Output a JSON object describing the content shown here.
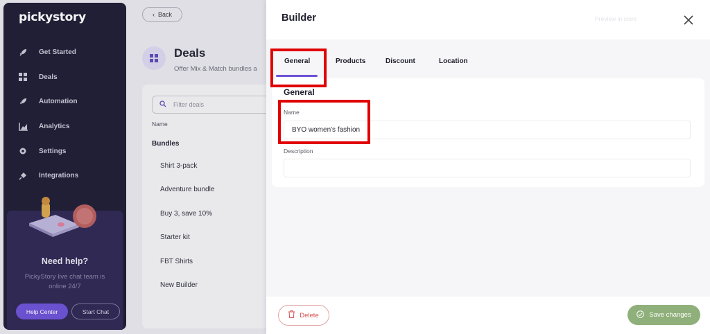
{
  "sidebar": {
    "logo": "pickystory",
    "items": [
      {
        "label": "Get Started",
        "icon": "rocket-icon"
      },
      {
        "label": "Deals",
        "icon": "grid-icon"
      },
      {
        "label": "Automation",
        "icon": "rocket-icon"
      },
      {
        "label": "Analytics",
        "icon": "chart-icon"
      },
      {
        "label": "Settings",
        "icon": "gear-icon"
      },
      {
        "label": "Integrations",
        "icon": "plug-icon"
      }
    ],
    "help": {
      "title": "Need help?",
      "text": "PickyStory live chat team is online 24/7",
      "help_center": "Help Center",
      "start_chat": "Start Chat"
    }
  },
  "main": {
    "back": "Back",
    "title": "Deals",
    "subtitle": "Offer Mix & Match bundles a",
    "filter_placeholder": "Filter deals",
    "column_name": "Name",
    "group": "Bundles",
    "deals": [
      "Shirt 3-pack",
      "Adventure bundle",
      "Buy 3, save 10%",
      "Starter kit",
      "FBT Shirts",
      "New Builder"
    ]
  },
  "drawer": {
    "title": "Builder",
    "header_ghost": "Preview in store",
    "tabs": [
      "General",
      "Products",
      "Discount",
      "Location"
    ],
    "active_tab": "General",
    "section_title": "General",
    "name_label": "Name",
    "name_value": "BYO women's fashion",
    "description_label": "Description",
    "description_value": "",
    "delete": "Delete",
    "save": "Save changes"
  },
  "colors": {
    "accent": "#6b52d6",
    "sidebar_bg": "#1b1830",
    "save_bg": "#8fb07a",
    "delete": "#d45151",
    "highlight": "#e00000"
  }
}
